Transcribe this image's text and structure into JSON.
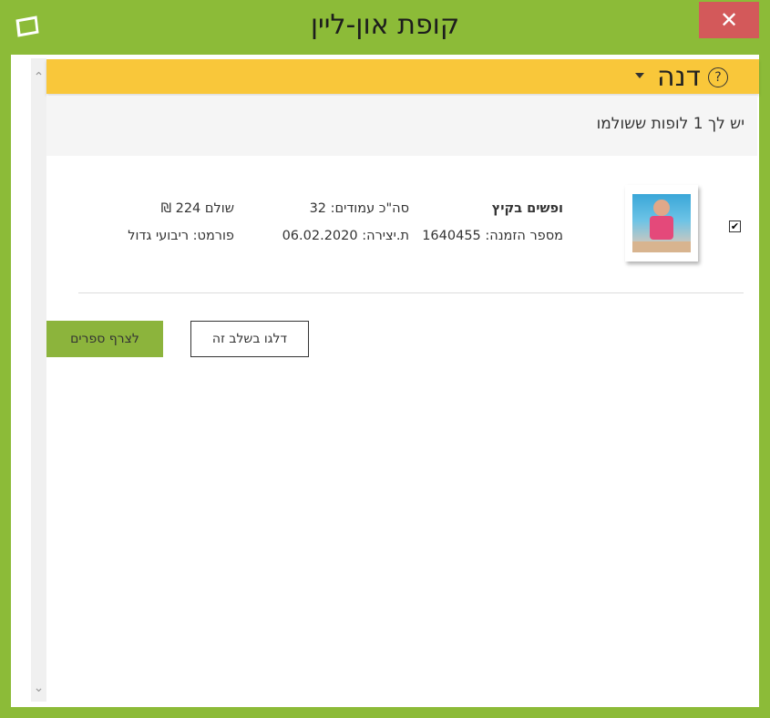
{
  "window": {
    "title": "קופת און-ליין",
    "close_label": "✕",
    "app_icon": "photo-frame-icon"
  },
  "user_bar": {
    "name": "דנה",
    "help_label": "?",
    "background": "#f9c73a"
  },
  "info": {
    "message": "יש לך 1 לופות ששולמו"
  },
  "order": {
    "checked_mark": "✔",
    "album_title": "ופשים בקיץ",
    "order_number": "מספר הזמנה: 1640455",
    "total_pages": "סה\"כ עמודים: 32",
    "created_date": "ת.יצירה: 06.02.2020",
    "paid": "שולם 224 ₪",
    "format": "פורמט: ריבועי גדול"
  },
  "buttons": {
    "skip_label": "דלגו בשלב זה",
    "attach_label": "לצרף ספרים"
  },
  "colors": {
    "frame_green": "#8cbb38",
    "close_red": "#d3595a",
    "attach_green": "#8cb43c"
  }
}
